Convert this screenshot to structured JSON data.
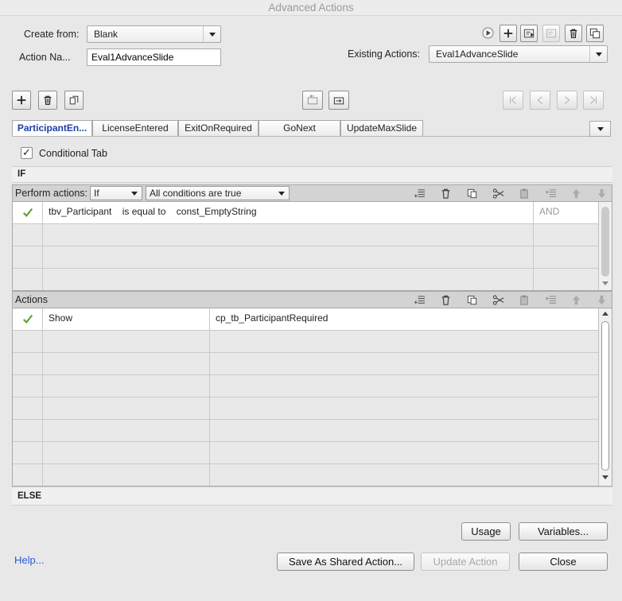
{
  "window": {
    "title": "Advanced Actions"
  },
  "form": {
    "create_from_label": "Create from:",
    "create_from_value": "Blank",
    "action_name_label": "Action Na...",
    "action_name_value": "Eval1AdvanceSlide",
    "existing_actions_label": "Existing Actions:",
    "existing_actions_value": "Eval1AdvanceSlide"
  },
  "tabs": [
    {
      "label": "ParticipantEn...",
      "active": true
    },
    {
      "label": "LicenseEntered",
      "active": false
    },
    {
      "label": "ExitOnRequired",
      "active": false
    },
    {
      "label": "GoNext",
      "active": false
    },
    {
      "label": "UpdateMaxSlide",
      "active": false
    }
  ],
  "conditional_tab": {
    "label": "Conditional Tab",
    "checked": true
  },
  "if_section": {
    "label": "IF"
  },
  "perform_actions": {
    "label": "Perform actions:",
    "mode": "If",
    "condition": "All conditions are true"
  },
  "conditions": {
    "rows": [
      {
        "checked": true,
        "variable": "tbv_Participant",
        "operator": "is equal to",
        "value": "const_EmptyString",
        "logic": "AND"
      },
      {
        "checked": false,
        "variable": "",
        "operator": "",
        "value": "",
        "logic": ""
      },
      {
        "checked": false,
        "variable": "",
        "operator": "",
        "value": "",
        "logic": ""
      },
      {
        "checked": false,
        "variable": "",
        "operator": "",
        "value": "",
        "logic": ""
      }
    ]
  },
  "actions": {
    "label": "Actions",
    "rows": [
      {
        "checked": true,
        "action": "Show",
        "target": "cp_tb_ParticipantRequired"
      },
      {
        "checked": false,
        "action": "",
        "target": ""
      },
      {
        "checked": false,
        "action": "",
        "target": ""
      },
      {
        "checked": false,
        "action": "",
        "target": ""
      },
      {
        "checked": false,
        "action": "",
        "target": ""
      },
      {
        "checked": false,
        "action": "",
        "target": ""
      },
      {
        "checked": false,
        "action": "",
        "target": ""
      },
      {
        "checked": false,
        "action": "",
        "target": ""
      }
    ]
  },
  "else_section": {
    "label": "ELSE"
  },
  "footer": {
    "help": "Help...",
    "usage": "Usage",
    "variables": "Variables...",
    "save_shared": "Save As Shared Action...",
    "update_action": "Update Action",
    "close": "Close"
  },
  "colors": {
    "active_tab": "#1f3fa6",
    "check_green": "#5aa02c",
    "link": "#2a5bd7"
  }
}
